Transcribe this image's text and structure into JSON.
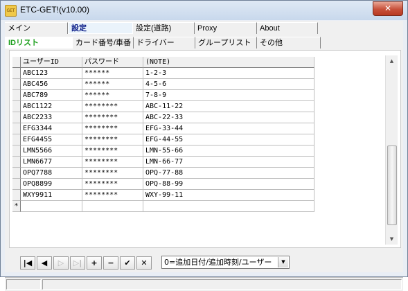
{
  "window": {
    "title": "ETC-GET!(v10.00)",
    "app_icon_label": "GET",
    "close_glyph": "✕"
  },
  "tabs_main": [
    {
      "label": "メイン"
    },
    {
      "label": "設定"
    },
    {
      "label": "設定(道路)"
    },
    {
      "label": "Proxy"
    },
    {
      "label": "About"
    }
  ],
  "tabs_sub": [
    {
      "label": "IDリスト"
    },
    {
      "label": "カード番号/車番"
    },
    {
      "label": "ドライバー"
    },
    {
      "label": "グループリスト"
    },
    {
      "label": "その他"
    }
  ],
  "grid": {
    "columns": [
      "ユーザーID",
      "パスワード",
      "(NOTE)"
    ],
    "rows": [
      [
        "ABC123",
        "******",
        "1-2-3"
      ],
      [
        "ABC456",
        "******",
        "4-5-6"
      ],
      [
        "ABC789",
        "******",
        "7-8-9"
      ],
      [
        "ABC1122",
        "********",
        "ABC-11-22"
      ],
      [
        "ABC2233",
        "********",
        "ABC-22-33"
      ],
      [
        "EFG3344",
        "********",
        "EFG-33-44"
      ],
      [
        "EFG4455",
        "********",
        "EFG-44-55"
      ],
      [
        "LMN5566",
        "********",
        "LMN-55-66"
      ],
      [
        "LMN6677",
        "********",
        "LMN-66-77"
      ],
      [
        "OPQ7788",
        "********",
        "OPQ-77-88"
      ],
      [
        "OPQ8899",
        "********",
        "OPQ-88-99"
      ],
      [
        "WXY9911",
        "********",
        "WXY-99-11"
      ]
    ],
    "new_row_marker": "*"
  },
  "navigator": {
    "first": "|◀",
    "prior": "◀",
    "next": "▷",
    "last": "▷|",
    "insert": "+",
    "delete": "−",
    "post": "✔",
    "cancel": "✕"
  },
  "sort_select": {
    "value": "0=追加日付/追加時刻/ユーザー"
  }
}
